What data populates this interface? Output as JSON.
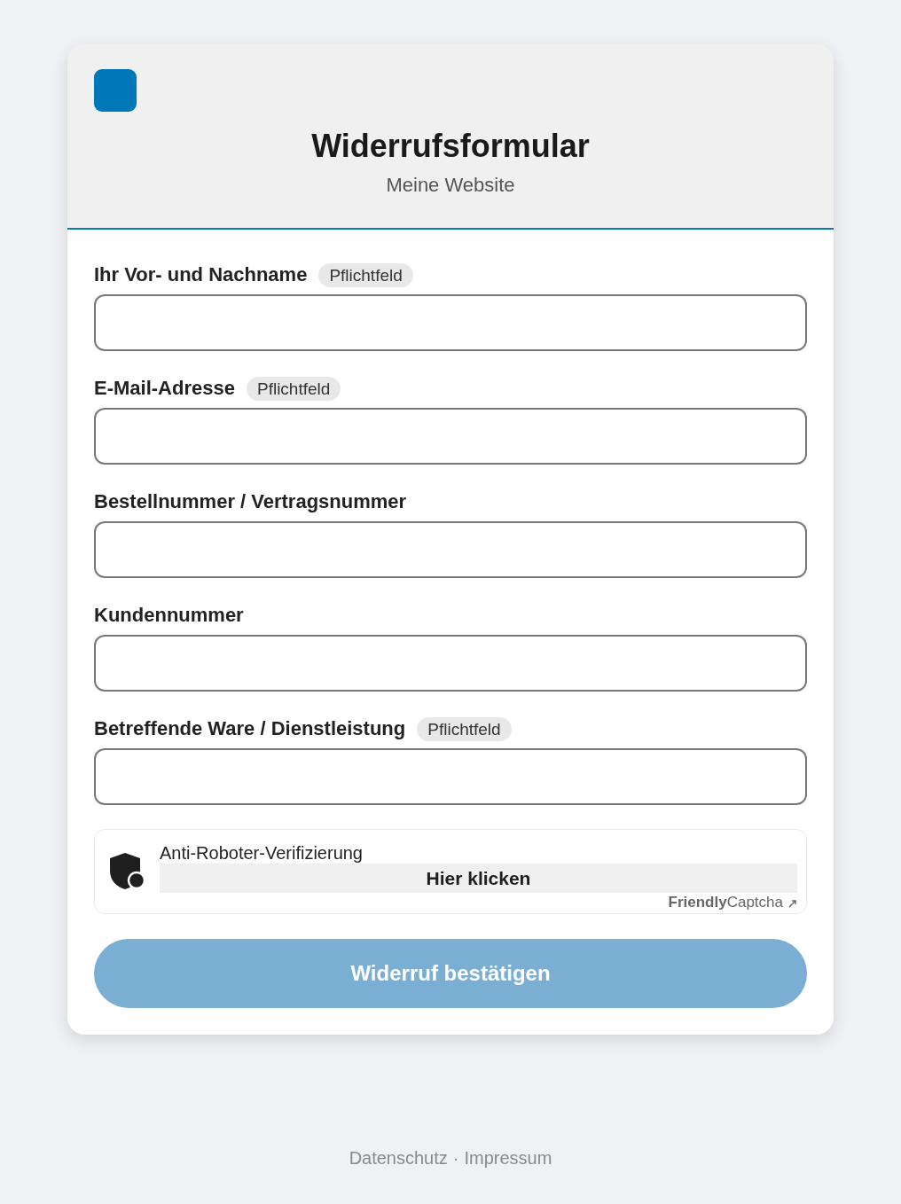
{
  "header": {
    "title": "Widerrufsformular",
    "subtitle": "Meine Website"
  },
  "fields": [
    {
      "label": "Ihr Vor- und Nachname",
      "badge": "Pflichtfeld"
    },
    {
      "label": "E-Mail-Adresse",
      "badge": "Pflichtfeld"
    },
    {
      "label": "Bestellnummer / Vertragsnummer"
    },
    {
      "label": "Kundennummer"
    },
    {
      "label": "Betreffende Ware / Dienstleistung",
      "badge": "Pflichtfeld"
    }
  ],
  "captcha": {
    "label": "Anti-Roboter-Verifizierung",
    "button": "Hier klicken",
    "brand": "**Friendly**Captcha"
  },
  "submit": {
    "label": "Widerruf bestätigen",
    "disabled": true
  },
  "footer": {
    "links": [
      "Datenschutz",
      "Impressum"
    ],
    "separator": "·"
  }
}
